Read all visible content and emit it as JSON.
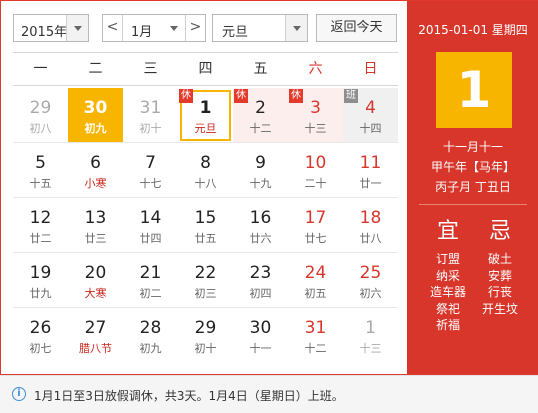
{
  "toolbar": {
    "year_value": "2015年",
    "prev_label": "<",
    "month_value": "1月",
    "next_label": ">",
    "holiday_value": "元旦",
    "today_button": "返回今天"
  },
  "weekdays": [
    "一",
    "二",
    "三",
    "四",
    "五",
    "六",
    "日"
  ],
  "weeks": [
    [
      {
        "day": "29",
        "lunar": "初八",
        "state": "other"
      },
      {
        "day": "30",
        "lunar": "初九",
        "state": "selected"
      },
      {
        "day": "31",
        "lunar": "初十",
        "state": "other"
      },
      {
        "day": "1",
        "lunar": "元旦",
        "state": "today",
        "tag": "休"
      },
      {
        "day": "2",
        "lunar": "十二",
        "state": "rest",
        "tag": "休"
      },
      {
        "day": "3",
        "lunar": "十三",
        "state": "rest",
        "tag": "休"
      },
      {
        "day": "4",
        "lunar": "十四",
        "state": "work",
        "tag": "班"
      }
    ],
    [
      {
        "day": "5",
        "lunar": "十五"
      },
      {
        "day": "6",
        "lunar": "小寒",
        "festival": true
      },
      {
        "day": "7",
        "lunar": "十七"
      },
      {
        "day": "8",
        "lunar": "十八"
      },
      {
        "day": "9",
        "lunar": "十九"
      },
      {
        "day": "10",
        "lunar": "二十"
      },
      {
        "day": "11",
        "lunar": "廿一"
      }
    ],
    [
      {
        "day": "12",
        "lunar": "廿二"
      },
      {
        "day": "13",
        "lunar": "廿三"
      },
      {
        "day": "14",
        "lunar": "廿四"
      },
      {
        "day": "15",
        "lunar": "廿五"
      },
      {
        "day": "16",
        "lunar": "廿六"
      },
      {
        "day": "17",
        "lunar": "廿七"
      },
      {
        "day": "18",
        "lunar": "廿八"
      }
    ],
    [
      {
        "day": "19",
        "lunar": "廿九"
      },
      {
        "day": "20",
        "lunar": "大寒",
        "festival": true
      },
      {
        "day": "21",
        "lunar": "初二"
      },
      {
        "day": "22",
        "lunar": "初三"
      },
      {
        "day": "23",
        "lunar": "初四"
      },
      {
        "day": "24",
        "lunar": "初五"
      },
      {
        "day": "25",
        "lunar": "初六"
      }
    ],
    [
      {
        "day": "26",
        "lunar": "初七"
      },
      {
        "day": "27",
        "lunar": "腊八节",
        "festival": true
      },
      {
        "day": "28",
        "lunar": "初九"
      },
      {
        "day": "29",
        "lunar": "初十"
      },
      {
        "day": "30",
        "lunar": "十一"
      },
      {
        "day": "31",
        "lunar": "十二"
      },
      {
        "day": "1",
        "lunar": "十三",
        "state": "other"
      }
    ]
  ],
  "panel": {
    "date_line": "2015-01-01 星期四",
    "big_day": "1",
    "lunar_date": "十一月十一",
    "year_gz": "甲午年【马年】",
    "month_day_gz": "丙子月 丁丑日",
    "yi_label": "宜",
    "ji_label": "忌",
    "yi_items": [
      "订盟",
      "纳采",
      "造车器",
      "祭祀",
      "祈福"
    ],
    "ji_items": [
      "破土",
      "安葬",
      "行丧",
      "开生坟"
    ]
  },
  "notice": {
    "icon": "info-icon",
    "text": "1月1日至3日放假调休，共3天。1月4日（星期日）上班。"
  },
  "colors": {
    "accent_red": "#d8362b",
    "highlight_yellow": "#f8b500",
    "info_blue": "#3b8fd9"
  }
}
